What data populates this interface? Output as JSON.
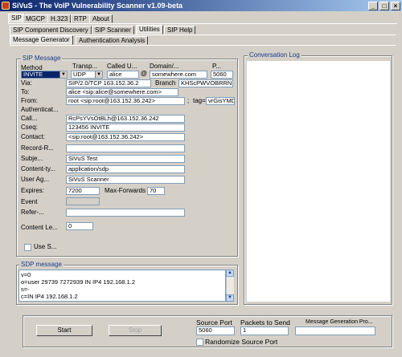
{
  "window": {
    "title": "SiVuS - The VoIP Vulnerability Scanner v1.09-beta",
    "min": "_",
    "max": "□",
    "close": "×"
  },
  "tabs_top": [
    {
      "label": "SIP"
    },
    {
      "label": "MGCP"
    },
    {
      "label": "H.323"
    },
    {
      "label": "RTP"
    },
    {
      "label": "About"
    }
  ],
  "tabs_second": [
    {
      "label": "SIP Component Discovery"
    },
    {
      "label": "SIP Scanner"
    },
    {
      "label": "Utilities"
    },
    {
      "label": "SIP Help"
    }
  ],
  "tabs_third": [
    {
      "label": "Message Generator"
    },
    {
      "label": "Authentication Analysis"
    }
  ],
  "sip_message": {
    "group_label": "SIP Message",
    "method_label": "Method",
    "transport_label": "Transp...",
    "called_label": "Called U...",
    "domain_label": "Domain/...",
    "port_label": "P...",
    "method_value": "INVITE",
    "transport_value": "UDP",
    "called_value": "alice",
    "at_sign": "@",
    "domain_value": "somewhere.com",
    "port_value": "5060",
    "via_label": "Via:",
    "via_value": "SIP/2.0/TCP 163.152.36.2",
    "branch_label": "Branch",
    "branch_value": "KHScPWVOBRRN",
    "to_label": "To:",
    "to_value": "alice <sip:alice@somewhere.com>",
    "from_label": "From:",
    "from_value": "root <sip:root@163.152.36.242>",
    "tag_sep": ";",
    "tag_label": "tag=",
    "tag_value": "vrGisYMDTd",
    "auth_label": "Authenticat...",
    "call_label": "Call...",
    "call_value": "RcPsYVsOtBLh@163.152.36.242",
    "cseq_label": "Cseq:",
    "cseq_value": "123456 INVITE",
    "contact_label": "Contact:",
    "contact_value": "<sip:root@163.152.36.242>",
    "record_label": "Record-R...",
    "subject_label": "Subje...",
    "subject_value": "SiVuS Test",
    "ctype_label": "Content-ty...",
    "ctype_value": "application/sdp",
    "ua_label": "User Ag...",
    "ua_value": "SiVuS Scanner",
    "expires_label": "Expires:",
    "expires_value": "7200",
    "maxfwd_label": "Max-Forwards",
    "maxfwd_value": "70",
    "event_label": "Event",
    "refer_label": "Refer-...",
    "clen_label": "Content Le...",
    "clen_value": "0",
    "use_label": "Use S..."
  },
  "sdp": {
    "group_label": "SDP message",
    "lines": "v=0\no=user 29739 7272939 IN IP4 192.168.1.2\ns=-\nc=IN IP4 192.168.1.2"
  },
  "conversation": {
    "group_label": "Conversation Log"
  },
  "bottom": {
    "start_label": "Start",
    "stop_label": "Stop",
    "source_port_label": "Source Port",
    "source_port_value": "5060",
    "packets_label": "Packets to Send",
    "packets_value": "1",
    "msg_progress_label": "Message Generation Pro...",
    "randomize_label": "Randomize Source Port"
  },
  "colors": {
    "accent": "#0a246a",
    "group_title": "#1a3b8f",
    "background": "#d4d0c8"
  }
}
